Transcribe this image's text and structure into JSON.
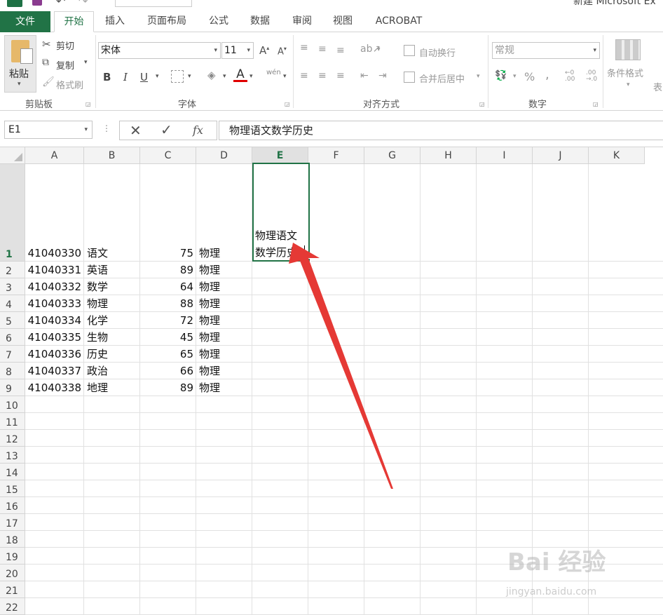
{
  "app_title": "新建 Microsoft Ex",
  "tabs": [
    {
      "label": "文件"
    },
    {
      "label": "开始"
    },
    {
      "label": "插入"
    },
    {
      "label": "页面布局"
    },
    {
      "label": "公式"
    },
    {
      "label": "数据"
    },
    {
      "label": "审阅"
    },
    {
      "label": "视图"
    },
    {
      "label": "ACROBAT"
    }
  ],
  "ribbon": {
    "clipboard": {
      "paste": "粘贴",
      "cut": "剪切",
      "copy": "复制",
      "format_painter": "格式刷",
      "group": "剪贴板"
    },
    "font": {
      "name": "宋体",
      "size": "11",
      "bold": "B",
      "italic": "I",
      "underline": "U",
      "font_color_glyph": "A",
      "phonetic": "wén",
      "group": "字体"
    },
    "alignment": {
      "wrap_text": "自动换行",
      "merge_center": "合并后居中",
      "group": "对齐方式"
    },
    "number": {
      "format": "常规",
      "percent": "%",
      "comma": ",",
      "group": "数字"
    },
    "styles": {
      "conditional": "条件格式",
      "table": "表"
    }
  },
  "formula_bar": {
    "name_box": "E1",
    "cancel": "✕",
    "enter": "✓",
    "fx": "fx",
    "content": "物理语文数学历史"
  },
  "columns": [
    "A",
    "B",
    "C",
    "D",
    "E",
    "F",
    "G",
    "H",
    "I",
    "J",
    "K"
  ],
  "rows": [
    "1",
    "2",
    "3",
    "4",
    "5",
    "6",
    "7",
    "8",
    "9",
    "10",
    "11",
    "12",
    "13",
    "14",
    "15",
    "16",
    "17",
    "18",
    "19",
    "20",
    "21",
    "22"
  ],
  "data_rows": [
    {
      "a": "41040330",
      "b": "语文",
      "c": "75",
      "d": "物理"
    },
    {
      "a": "41040331",
      "b": "英语",
      "c": "89",
      "d": "物理"
    },
    {
      "a": "41040332",
      "b": "数学",
      "c": "64",
      "d": "物理"
    },
    {
      "a": "41040333",
      "b": "物理",
      "c": "88",
      "d": "物理"
    },
    {
      "a": "41040334",
      "b": "化学",
      "c": "72",
      "d": "物理"
    },
    {
      "a": "41040335",
      "b": "生物",
      "c": "45",
      "d": "物理"
    },
    {
      "a": "41040336",
      "b": "历史",
      "c": "65",
      "d": "物理"
    },
    {
      "a": "41040337",
      "b": "政治",
      "c": "66",
      "d": "物理"
    },
    {
      "a": "41040338",
      "b": "地理",
      "c": "89",
      "d": "物理"
    }
  ],
  "active_cell": {
    "line1": "物理语文",
    "line2": "数学历史"
  },
  "watermark": {
    "main": "Bai 经验",
    "sub": "jingyan.baidu.com"
  },
  "colors": {
    "excel_green": "#217346",
    "arrow_red": "#e53935"
  }
}
